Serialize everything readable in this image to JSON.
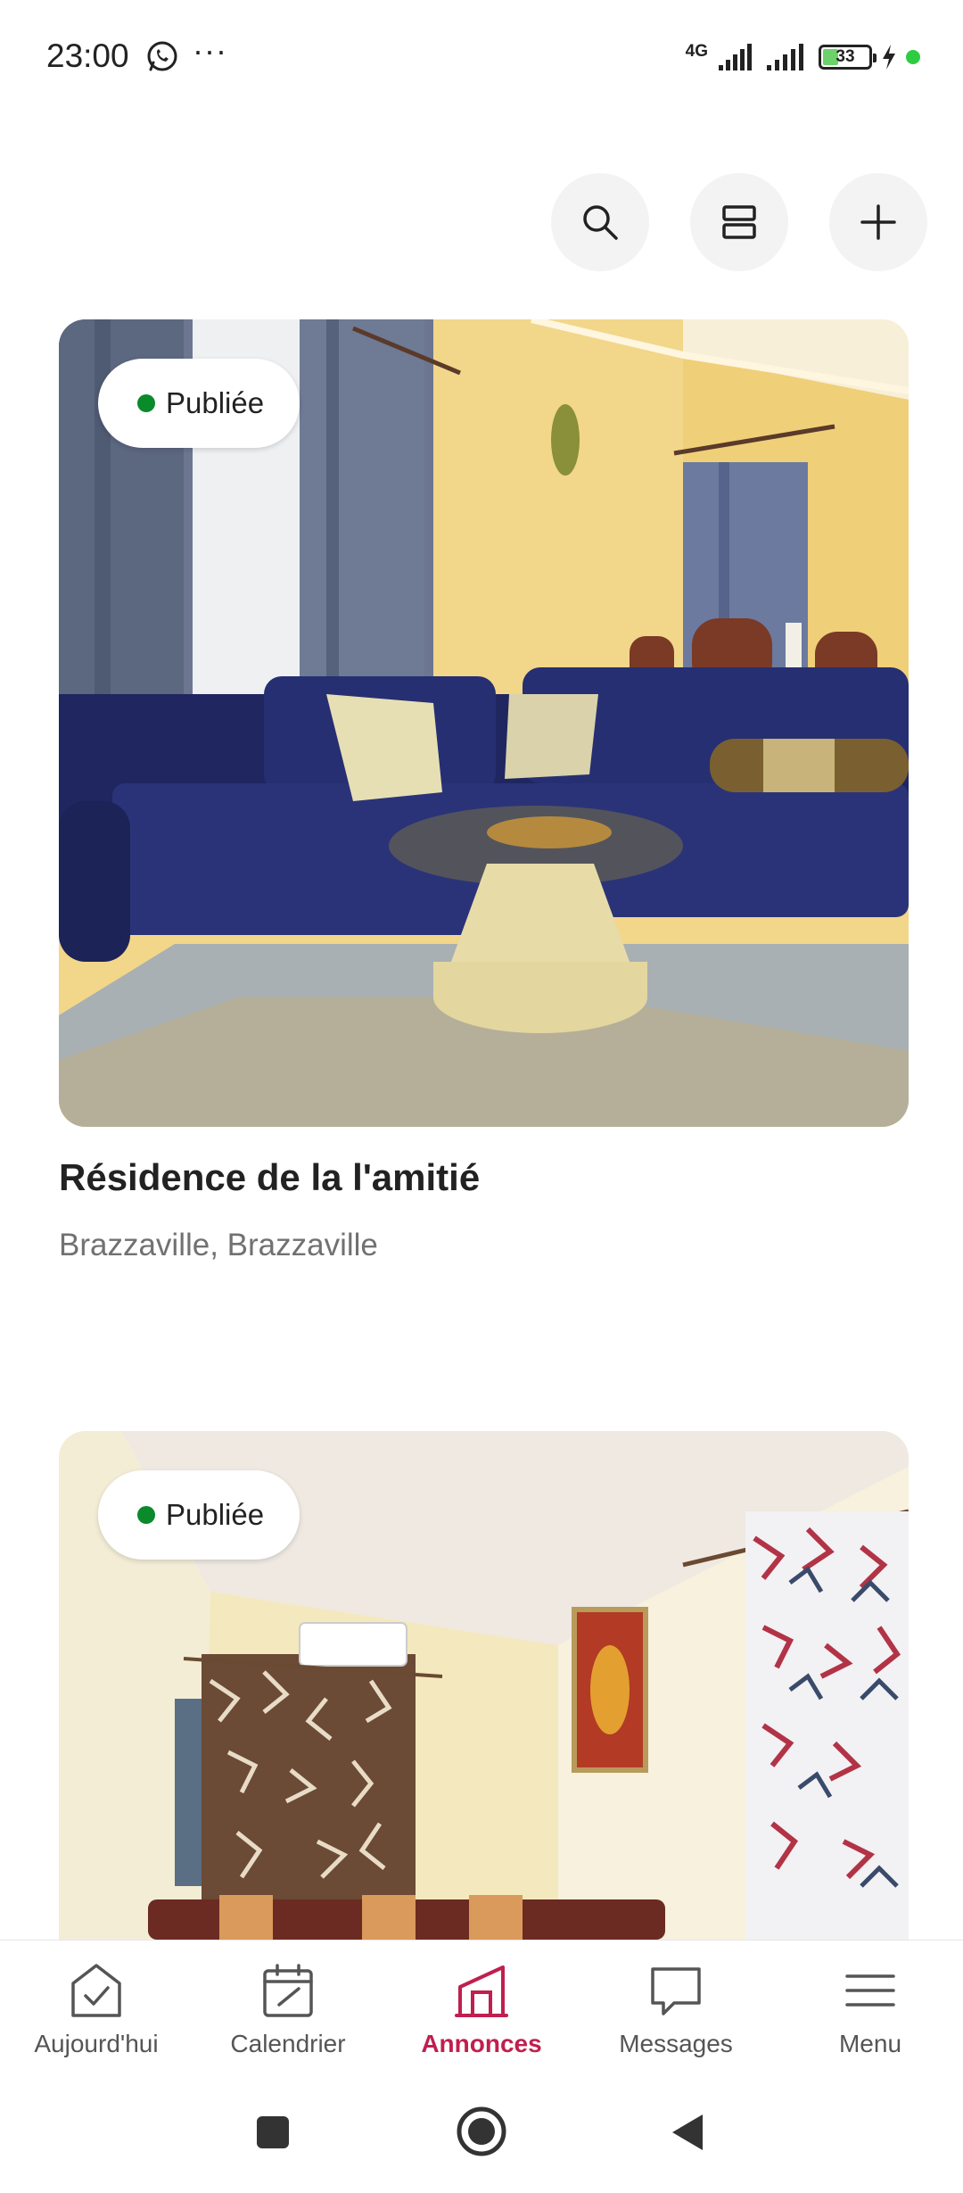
{
  "status_bar": {
    "time": "23:00",
    "whatsapp_icon": "whatsapp-icon",
    "more_icon": "more-dots-icon",
    "network_type": "4G",
    "battery_level": "33",
    "battery_percent": 33,
    "colors": {
      "battery": "#6dd16a",
      "dot": "#2ecc40"
    }
  },
  "toolbar": {
    "search_icon": "search-icon",
    "view_icon": "view-toggle-icon",
    "add_icon": "plus-icon"
  },
  "listings": [
    {
      "status": "Publiée",
      "title": "Résidence de la l'amitié",
      "location": "Brazzaville, Brazzaville",
      "photo": "living room with blue sectional sofa, yellow walls, grey curtains, round coffee table"
    },
    {
      "status": "Publiée",
      "title": "",
      "location": "",
      "photo": "living room with patterned curtains, air conditioner, framed painting"
    }
  ],
  "bottom_nav": {
    "items": [
      {
        "label": "Aujourd'hui",
        "icon": "today-check-icon",
        "active": false
      },
      {
        "label": "Calendrier",
        "icon": "calendar-icon",
        "active": false
      },
      {
        "label": "Annonces",
        "icon": "listings-house-icon",
        "active": true
      },
      {
        "label": "Messages",
        "icon": "message-bubble-icon",
        "active": false
      },
      {
        "label": "Menu",
        "icon": "menu-hamburger-icon",
        "active": false
      }
    ],
    "active_color": "#c01f4f"
  },
  "system_nav": {
    "recents_icon": "square-icon",
    "home_icon": "circle-home-icon",
    "back_icon": "back-triangle-icon"
  }
}
